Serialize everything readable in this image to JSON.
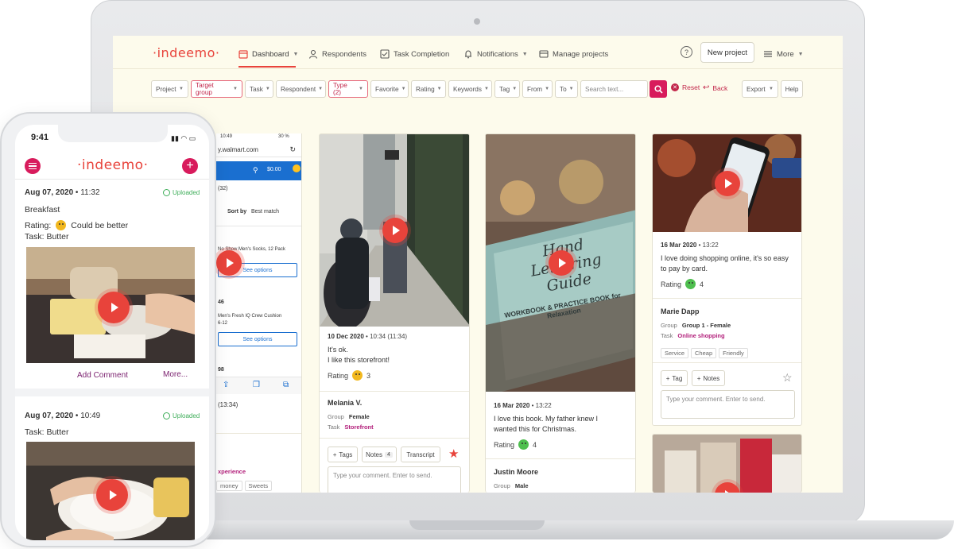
{
  "brand": {
    "logo_text": "·indeemo·",
    "accent": "#e8433b",
    "primary": "#d81b5c"
  },
  "nav": {
    "dashboard": "Dashboard",
    "respondents": "Respondents",
    "task_completion": "Task Completion",
    "notifications": "Notifications",
    "manage_projects": "Manage projects",
    "new_project": "New project",
    "more": "More",
    "help_symbol": "?"
  },
  "filters": {
    "project": "Project",
    "target_group": "Target group",
    "task": "Task",
    "respondent": "Respondent",
    "type": "Type (2)",
    "favorite": "Favorite",
    "rating": "Rating",
    "keywords": "Keywords",
    "tag": "Tag",
    "from": "From",
    "to": "To",
    "search_placeholder": "Search text...",
    "reset": "Reset",
    "back": "Back",
    "export": "Export",
    "help": "Help"
  },
  "browser": {
    "time": "10:49",
    "battery": "30 %",
    "url": "y.walmart.com",
    "cart": "$0.00",
    "results_count": "(32)",
    "sort_label": "Sort by",
    "sort_value": "Best match",
    "item1": "No Show Men's Socks, 12 Pack",
    "see_options": "See options",
    "price1": "46",
    "item2": "Men's Fresh IQ Crew Cushion",
    "item2_size": "6-12",
    "price2": "98",
    "duration": "(13:34)",
    "task_frag": "xperience",
    "tag_a": "money",
    "tag_b": "Sweets"
  },
  "cards": [
    {
      "date": "10 Dec 2020",
      "time": "10:34 (11:34)",
      "text_line1": "It's ok.",
      "text_line2": "I like this storefront!",
      "rating_label": "Rating",
      "rating_value": "3",
      "person": "Melania V.",
      "group_label": "Group",
      "group_value": "Female",
      "task_label": "Task",
      "task_value": "Storefront",
      "tags_btn": "Tags",
      "notes_btn": "Notes",
      "notes_count": "4",
      "transcript_btn": "Transcript",
      "comment_placeholder": "Type your comment. Enter to send."
    },
    {
      "date": "16 Mar 2020",
      "time": "13:22",
      "text_line1": "I love this book. My father knew I",
      "text_line2": "wanted this for Christmas.",
      "rating_label": "Rating",
      "rating_value": "4",
      "person": "Justin Moore",
      "group_label": "Group",
      "group_value": "Male",
      "book_title": "Hand Lettering Guide",
      "book_sub": "WORKBOOK & PRACTICE BOOK for Relaxation"
    },
    {
      "date": "16 Mar 2020",
      "time": "13:22",
      "text_line1": "I love doing shopping online, it's so easy",
      "text_line2": "to pay by card.",
      "rating_label": "Rating",
      "rating_value": "4",
      "person": "Marie Dapp",
      "group_label": "Group",
      "group_value": "Group 1 - Female",
      "task_label": "Task",
      "task_value": "Online shopping",
      "tags": [
        "Service",
        "Cheap",
        "Friendly"
      ],
      "tag_btn": "Tag",
      "notes_btn": "Notes",
      "comment_placeholder": "Type your comment. Enter to send."
    }
  ],
  "phone": {
    "time": "9:41",
    "entry1": {
      "date": "Aug 07, 2020",
      "time": "11:32",
      "status": "Uploaded",
      "title": "Breakfast",
      "rating_label": "Rating:",
      "rating_text": "Could be better",
      "task_label": "Task:",
      "task_value": "Butter",
      "add_comment": "Add Comment",
      "more": "More..."
    },
    "entry2": {
      "date": "Aug 07, 2020",
      "time": "10:49",
      "status": "Uploaded",
      "task_label": "Task:",
      "task_value": "Butter"
    }
  }
}
